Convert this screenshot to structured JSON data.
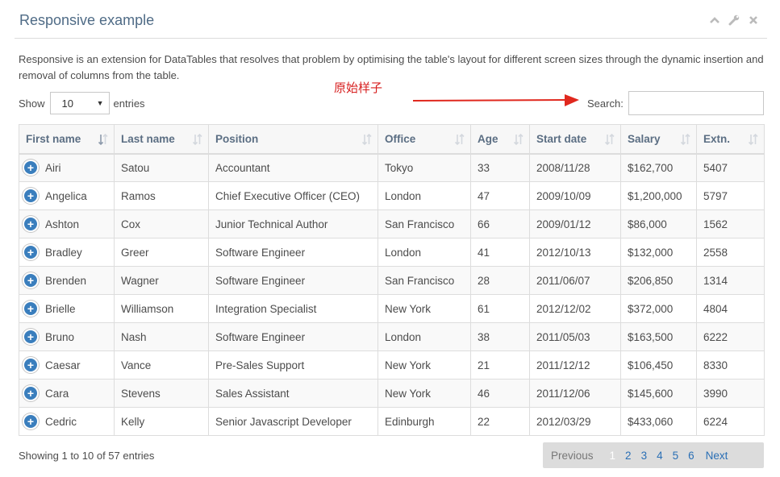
{
  "header": {
    "title": "Responsive example"
  },
  "description": "Responsive is an extension for DataTables that resolves that problem by optimising the table's layout for different screen sizes through the dynamic insertion and removal of columns from the table.",
  "length_menu": {
    "show_label": "Show",
    "value": "10",
    "entries_label": "entries"
  },
  "annotation": {
    "text": "原始样子",
    "color": "#d71f1f"
  },
  "search": {
    "label": "Search:",
    "value": "",
    "placeholder": ""
  },
  "table": {
    "columns": [
      "First name",
      "Last name",
      "Position",
      "Office",
      "Age",
      "Start date",
      "Salary",
      "Extn."
    ],
    "rows": [
      [
        "Airi",
        "Satou",
        "Accountant",
        "Tokyo",
        "33",
        "2008/11/28",
        "$162,700",
        "5407"
      ],
      [
        "Angelica",
        "Ramos",
        "Chief Executive Officer (CEO)",
        "London",
        "47",
        "2009/10/09",
        "$1,200,000",
        "5797"
      ],
      [
        "Ashton",
        "Cox",
        "Junior Technical Author",
        "San Francisco",
        "66",
        "2009/01/12",
        "$86,000",
        "1562"
      ],
      [
        "Bradley",
        "Greer",
        "Software Engineer",
        "London",
        "41",
        "2012/10/13",
        "$132,000",
        "2558"
      ],
      [
        "Brenden",
        "Wagner",
        "Software Engineer",
        "San Francisco",
        "28",
        "2011/06/07",
        "$206,850",
        "1314"
      ],
      [
        "Brielle",
        "Williamson",
        "Integration Specialist",
        "New York",
        "61",
        "2012/12/02",
        "$372,000",
        "4804"
      ],
      [
        "Bruno",
        "Nash",
        "Software Engineer",
        "London",
        "38",
        "2011/05/03",
        "$163,500",
        "6222"
      ],
      [
        "Caesar",
        "Vance",
        "Pre-Sales Support",
        "New York",
        "21",
        "2011/12/12",
        "$106,450",
        "8330"
      ],
      [
        "Cara",
        "Stevens",
        "Sales Assistant",
        "New York",
        "46",
        "2011/12/06",
        "$145,600",
        "3990"
      ],
      [
        "Cedric",
        "Kelly",
        "Senior Javascript Developer",
        "Edinburgh",
        "22",
        "2012/03/29",
        "$433,060",
        "6224"
      ]
    ]
  },
  "info": "Showing 1 to 10 of 57 entries",
  "pagination": {
    "previous": "Previous",
    "pages": [
      "1",
      "2",
      "3",
      "4",
      "5",
      "6"
    ],
    "current": "1",
    "next": "Next"
  },
  "colors": {
    "accent": "#3a7ebd",
    "title": "#4f6b86",
    "link": "#2a6fb5"
  }
}
